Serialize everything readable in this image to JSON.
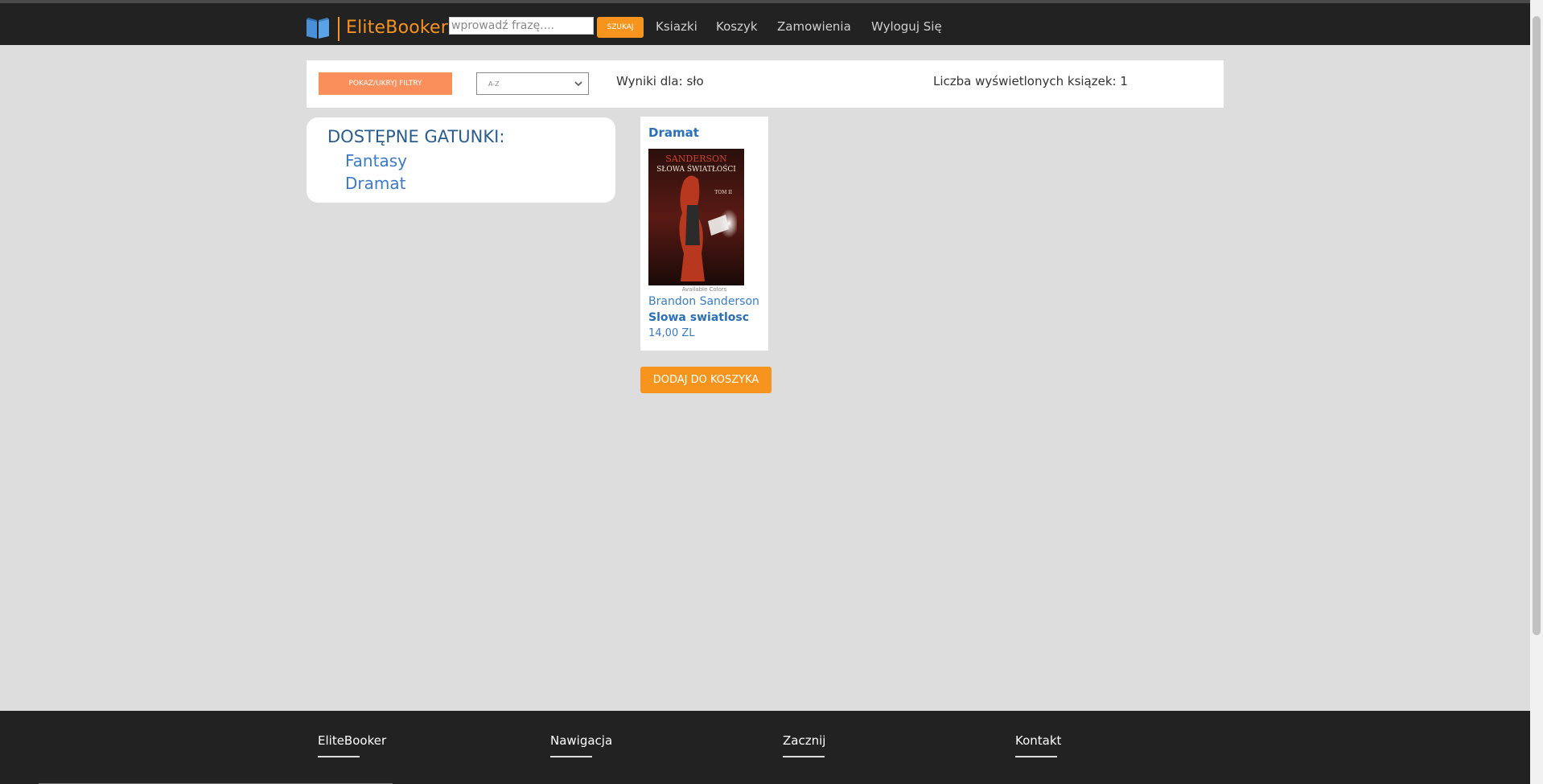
{
  "header": {
    "logo_text": "EliteBooker",
    "search": {
      "placeholder": "wprowadź frazę....",
      "button_label": "SZUKAJ"
    },
    "nav": [
      {
        "label": "Ksiazki"
      },
      {
        "label": "Koszyk"
      },
      {
        "label": "Zamowienia"
      },
      {
        "label": "Wyloguj Się"
      }
    ]
  },
  "toolbar": {
    "filters_button_label": "POKAZ/UKRYJ FILTRY",
    "sort_selected": "A-Z",
    "results_text": "Wyniki dla: sło",
    "count_text": "Liczba wyświetlonych ksiązek: 1"
  },
  "genres": {
    "title": "DOSTĘPNE GATUNKI:",
    "items": [
      {
        "label": "Fantasy"
      },
      {
        "label": "Dramat"
      }
    ]
  },
  "book": {
    "genre": "Dramat",
    "cover_caption": "Available Colors",
    "cover_author_text": "SANDERSON",
    "cover_title_text": "SŁOWA ŚWIATŁOŚCI",
    "cover_volume_text": "TOM II",
    "author": "Brandon Sanderson",
    "title": "Slowa swiatlosc",
    "price": "14,00 ZL",
    "add_to_cart_label": "DODAJ DO KOSZYKA"
  },
  "footer": {
    "columns": [
      {
        "heading": "EliteBooker"
      },
      {
        "heading": "Nawigacja"
      },
      {
        "heading": "Zacznij"
      },
      {
        "heading": "Kontakt"
      }
    ]
  },
  "colors": {
    "accent": "#f7941d",
    "filters_button": "#fb8f5c",
    "navbar": "#222222",
    "page_background": "#dddddd",
    "link_blue": "#3a7bc8"
  }
}
